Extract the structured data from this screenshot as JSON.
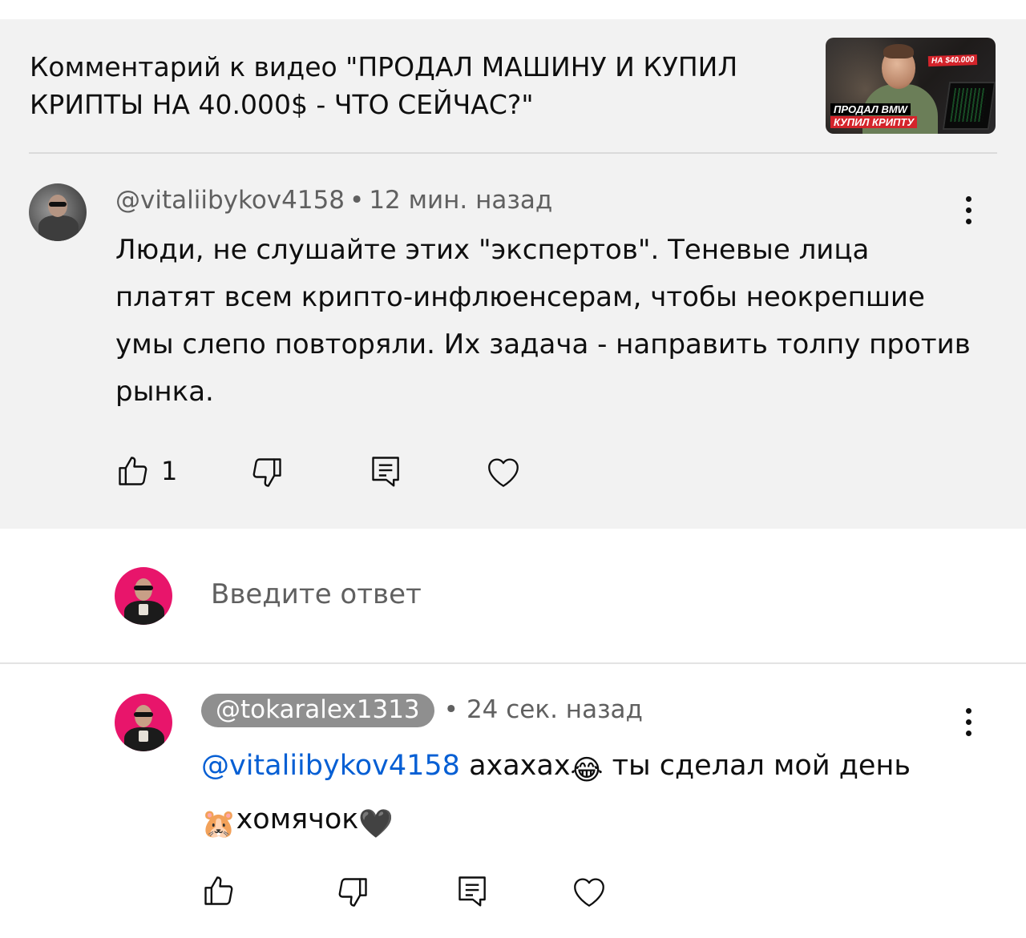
{
  "header": {
    "title": "Комментарий к видео \"ПРОДАЛ МАШИНУ И КУПИЛ КРИПТЫ НА 40.000$ - ЧТО СЕЙЧАС?\"",
    "thumbnail": {
      "tag": "НА $40.000",
      "caption_line1": "ПРОДАЛ BMW",
      "caption_line2": "КУПИЛ КРИПТУ"
    }
  },
  "comment": {
    "author": "@vitaliibykov4158",
    "separator": "•",
    "time": "12 мин. назад",
    "text": "Люди, не слушайте этих \"экспертов\". Теневые лица платят всем крипто-инфлюенсерам, чтобы неокрепшие умы слепо повторяли. Их задача - направить толпу против рынка.",
    "likes": "1"
  },
  "reply_input": {
    "placeholder": "Введите ответ"
  },
  "reply": {
    "author": "@tokaralex1313",
    "separator": "•",
    "time": "24 сек. назад",
    "mention": "@vitaliibykov4158",
    "text_part1": " ахахах",
    "emoji1": "😂",
    "text_part2": " ты сделал мой день ",
    "emoji2": "🐹",
    "text_part3": "хомячок",
    "emoji3": "🖤"
  },
  "icons": {
    "like": "thumb-up-icon",
    "dislike": "thumb-down-icon",
    "reply": "comment-icon",
    "heart": "heart-icon",
    "menu": "more-vertical-icon"
  },
  "colors": {
    "panel_bg": "#f2f2f2",
    "mention": "#065fd4",
    "meta_text": "#606060",
    "avatar_pink": "#e8156b",
    "pill_bg": "#8f8f8f"
  }
}
